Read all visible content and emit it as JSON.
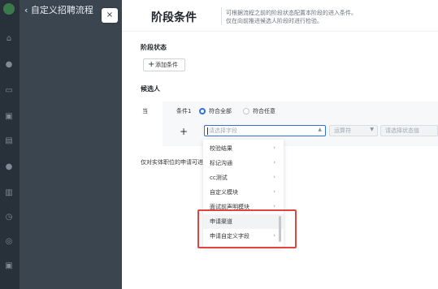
{
  "app": {
    "back_title": "‹  自定义招聘流程"
  },
  "dialog": {
    "close_label": "×",
    "title": "阶段条件",
    "desc_line1": "可根据流程之前的阶段状态配置本阶段的进入条件。",
    "desc_line2": "仅在向前推进候选人阶段时进行检验。"
  },
  "stage_status": {
    "heading": "阶段状态",
    "add_button": "添加条件"
  },
  "candidate": {
    "heading": "候选人",
    "when_label": "当",
    "condition_label": "条件1",
    "match_all": "符合全部",
    "match_any": "符合任意",
    "add_symbol": "+",
    "field_placeholder": "请选择字段",
    "operator_placeholder": "运算符",
    "value_placeholder": "请选择状态值"
  },
  "apply_note": "仅对实体职位的申请可进",
  "dropdown": {
    "items": [
      {
        "label": "校验结果",
        "has_children": true
      },
      {
        "label": "标记沟通",
        "has_children": true
      },
      {
        "label": "cc测试",
        "has_children": true
      },
      {
        "label": "自定义模块",
        "has_children": true
      },
      {
        "label": "面试前声明模块",
        "has_children": true
      },
      {
        "label": "申请渠道",
        "has_children": false
      },
      {
        "label": "申请自定义字段",
        "has_children": true
      }
    ],
    "chevron": "›"
  },
  "sidebar": {
    "icons": [
      "home-icon",
      "people-icon",
      "inbox-icon",
      "card-icon",
      "briefcase-icon",
      "document-icon",
      "user-icon",
      "book-icon",
      "clock-icon",
      "globe-icon",
      "lock-icon"
    ]
  },
  "colors": {
    "accent": "#2f6fde",
    "highlight_border": "#e0443e"
  }
}
